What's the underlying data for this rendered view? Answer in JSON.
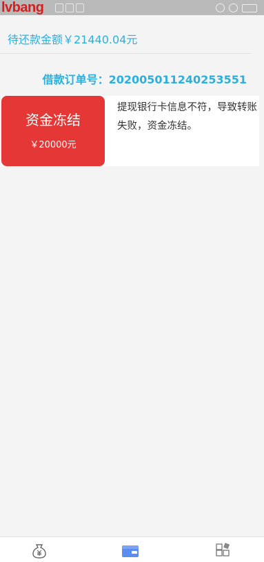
{
  "statusbar": {
    "brand": "lvbang"
  },
  "summary": {
    "pending_repayment": "待还款金额￥21440.04元"
  },
  "loan": {
    "order_label": "借款订单号：202005011240253551",
    "status_title": "资金冻结",
    "status_amount": "￥20000元",
    "reason": "提现银行卡信息不符，导致转账失败，资金冻结。"
  },
  "bottom_nav": {
    "items": [
      {
        "icon": "money-bag-icon"
      },
      {
        "icon": "wallet-icon",
        "active": true
      },
      {
        "icon": "grid-apps-icon"
      }
    ]
  },
  "colors": {
    "accent": "#2bb0de",
    "status_red": "#e63737",
    "wallet_blue": "#5b8def"
  }
}
